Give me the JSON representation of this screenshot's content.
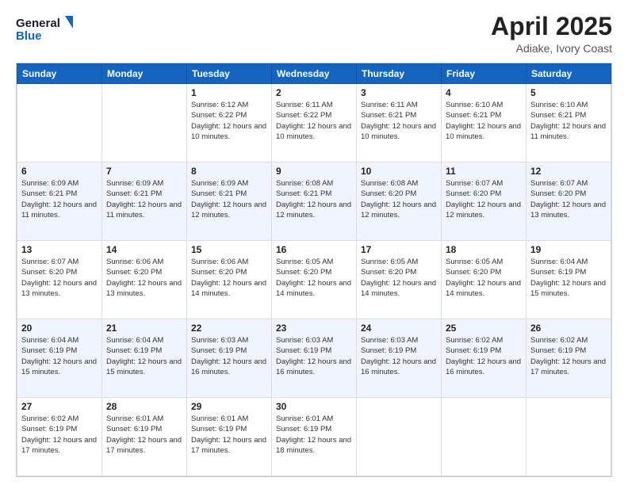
{
  "header": {
    "logo_line1": "General",
    "logo_line2": "Blue",
    "title": "April 2025",
    "subtitle": "Adiake, Ivory Coast"
  },
  "days_of_week": [
    "Sunday",
    "Monday",
    "Tuesday",
    "Wednesday",
    "Thursday",
    "Friday",
    "Saturday"
  ],
  "weeks": [
    [
      {
        "day": "",
        "info": ""
      },
      {
        "day": "",
        "info": ""
      },
      {
        "day": "1",
        "info": "Sunrise: 6:12 AM\nSunset: 6:22 PM\nDaylight: 12 hours and 10 minutes."
      },
      {
        "day": "2",
        "info": "Sunrise: 6:11 AM\nSunset: 6:22 PM\nDaylight: 12 hours and 10 minutes."
      },
      {
        "day": "3",
        "info": "Sunrise: 6:11 AM\nSunset: 6:21 PM\nDaylight: 12 hours and 10 minutes."
      },
      {
        "day": "4",
        "info": "Sunrise: 6:10 AM\nSunset: 6:21 PM\nDaylight: 12 hours and 10 minutes."
      },
      {
        "day": "5",
        "info": "Sunrise: 6:10 AM\nSunset: 6:21 PM\nDaylight: 12 hours and 11 minutes."
      }
    ],
    [
      {
        "day": "6",
        "info": "Sunrise: 6:09 AM\nSunset: 6:21 PM\nDaylight: 12 hours and 11 minutes."
      },
      {
        "day": "7",
        "info": "Sunrise: 6:09 AM\nSunset: 6:21 PM\nDaylight: 12 hours and 11 minutes."
      },
      {
        "day": "8",
        "info": "Sunrise: 6:09 AM\nSunset: 6:21 PM\nDaylight: 12 hours and 12 minutes."
      },
      {
        "day": "9",
        "info": "Sunrise: 6:08 AM\nSunset: 6:21 PM\nDaylight: 12 hours and 12 minutes."
      },
      {
        "day": "10",
        "info": "Sunrise: 6:08 AM\nSunset: 6:20 PM\nDaylight: 12 hours and 12 minutes."
      },
      {
        "day": "11",
        "info": "Sunrise: 6:07 AM\nSunset: 6:20 PM\nDaylight: 12 hours and 12 minutes."
      },
      {
        "day": "12",
        "info": "Sunrise: 6:07 AM\nSunset: 6:20 PM\nDaylight: 12 hours and 13 minutes."
      }
    ],
    [
      {
        "day": "13",
        "info": "Sunrise: 6:07 AM\nSunset: 6:20 PM\nDaylight: 12 hours and 13 minutes."
      },
      {
        "day": "14",
        "info": "Sunrise: 6:06 AM\nSunset: 6:20 PM\nDaylight: 12 hours and 13 minutes."
      },
      {
        "day": "15",
        "info": "Sunrise: 6:06 AM\nSunset: 6:20 PM\nDaylight: 12 hours and 14 minutes."
      },
      {
        "day": "16",
        "info": "Sunrise: 6:05 AM\nSunset: 6:20 PM\nDaylight: 12 hours and 14 minutes."
      },
      {
        "day": "17",
        "info": "Sunrise: 6:05 AM\nSunset: 6:20 PM\nDaylight: 12 hours and 14 minutes."
      },
      {
        "day": "18",
        "info": "Sunrise: 6:05 AM\nSunset: 6:20 PM\nDaylight: 12 hours and 14 minutes."
      },
      {
        "day": "19",
        "info": "Sunrise: 6:04 AM\nSunset: 6:19 PM\nDaylight: 12 hours and 15 minutes."
      }
    ],
    [
      {
        "day": "20",
        "info": "Sunrise: 6:04 AM\nSunset: 6:19 PM\nDaylight: 12 hours and 15 minutes."
      },
      {
        "day": "21",
        "info": "Sunrise: 6:04 AM\nSunset: 6:19 PM\nDaylight: 12 hours and 15 minutes."
      },
      {
        "day": "22",
        "info": "Sunrise: 6:03 AM\nSunset: 6:19 PM\nDaylight: 12 hours and 16 minutes."
      },
      {
        "day": "23",
        "info": "Sunrise: 6:03 AM\nSunset: 6:19 PM\nDaylight: 12 hours and 16 minutes."
      },
      {
        "day": "24",
        "info": "Sunrise: 6:03 AM\nSunset: 6:19 PM\nDaylight: 12 hours and 16 minutes."
      },
      {
        "day": "25",
        "info": "Sunrise: 6:02 AM\nSunset: 6:19 PM\nDaylight: 12 hours and 16 minutes."
      },
      {
        "day": "26",
        "info": "Sunrise: 6:02 AM\nSunset: 6:19 PM\nDaylight: 12 hours and 17 minutes."
      }
    ],
    [
      {
        "day": "27",
        "info": "Sunrise: 6:02 AM\nSunset: 6:19 PM\nDaylight: 12 hours and 17 minutes."
      },
      {
        "day": "28",
        "info": "Sunrise: 6:01 AM\nSunset: 6:19 PM\nDaylight: 12 hours and 17 minutes."
      },
      {
        "day": "29",
        "info": "Sunrise: 6:01 AM\nSunset: 6:19 PM\nDaylight: 12 hours and 17 minutes."
      },
      {
        "day": "30",
        "info": "Sunrise: 6:01 AM\nSunset: 6:19 PM\nDaylight: 12 hours and 18 minutes."
      },
      {
        "day": "",
        "info": ""
      },
      {
        "day": "",
        "info": ""
      },
      {
        "day": "",
        "info": ""
      }
    ]
  ]
}
